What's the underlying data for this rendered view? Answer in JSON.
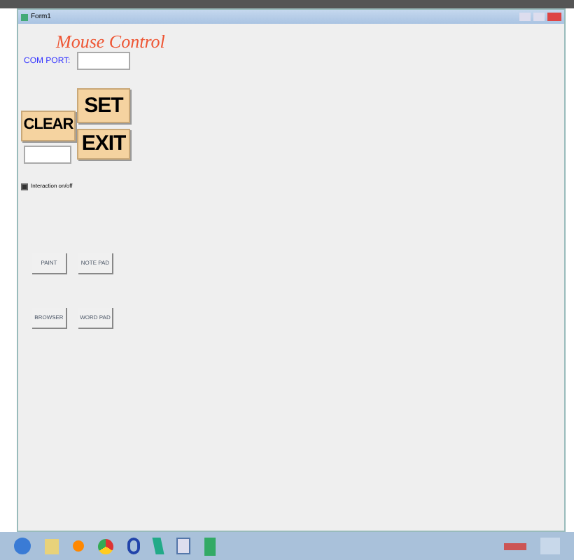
{
  "window": {
    "title": "Form1"
  },
  "heading": "Mouse Control",
  "com_port": {
    "label": "COM PORT:"
  },
  "buttons": {
    "clear": "CLEAR",
    "set": "SET",
    "exit": "EXIT"
  },
  "checkbox": {
    "label": "Interaction on/off",
    "checked": true
  },
  "app_buttons": [
    {
      "label": "PAINT"
    },
    {
      "label": "NOTE PAD"
    },
    {
      "label": "BROWSER"
    },
    {
      "label": "WORD PAD"
    }
  ]
}
